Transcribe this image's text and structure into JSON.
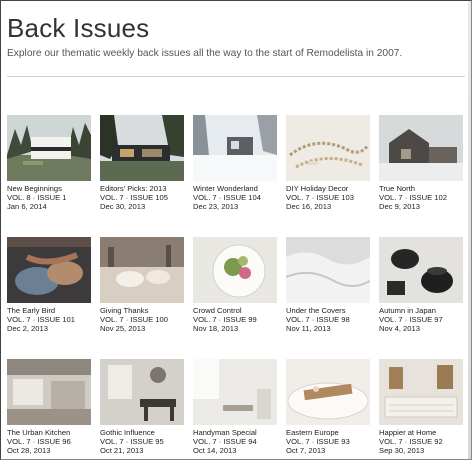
{
  "header": {
    "title": "Back Issues",
    "subtitle": "Explore our thematic weekly back issues all the way to the start of Remodelista in 2007."
  },
  "issues": [
    {
      "title": "New Beginnings",
      "volume": "VOL. 8 · ISSUE 1",
      "date": "Jan 6, 2014",
      "thumb_icon": "modern-house-in-trees-image"
    },
    {
      "title": "Editors' Picks: 2013",
      "volume": "VOL. 7 · ISSUE 105",
      "date": "Dec 30, 2013",
      "thumb_icon": "dark-house-at-dusk-image"
    },
    {
      "title": "Winter Wonderland",
      "volume": "VOL. 7 · ISSUE 104",
      "date": "Dec 23, 2013",
      "thumb_icon": "snowy-cabin-image"
    },
    {
      "title": "DIY Holiday Decor",
      "volume": "VOL. 7 · ISSUE 103",
      "date": "Dec 16, 2013",
      "thumb_icon": "beaded-garland-image"
    },
    {
      "title": "True North",
      "volume": "VOL. 7 · ISSUE 102",
      "date": "Dec 9, 2013",
      "thumb_icon": "barn-house-image"
    },
    {
      "title": "The Early Bird",
      "volume": "VOL. 7 · ISSUE 101",
      "date": "Dec 2, 2013",
      "thumb_icon": "knitting-hands-image"
    },
    {
      "title": "Giving Thanks",
      "volume": "VOL. 7 · ISSUE 100",
      "date": "Nov 25, 2013",
      "thumb_icon": "table-setting-image"
    },
    {
      "title": "Crowd Control",
      "volume": "VOL. 7 · ISSUE 99",
      "date": "Nov 18, 2013",
      "thumb_icon": "salad-plate-image"
    },
    {
      "title": "Under the Covers",
      "volume": "VOL. 7 · ISSUE 98",
      "date": "Nov 11, 2013",
      "thumb_icon": "bed-linens-image"
    },
    {
      "title": "Autumn in Japan",
      "volume": "VOL. 7 · ISSUE 97",
      "date": "Nov 4, 2013",
      "thumb_icon": "tea-kettles-image"
    },
    {
      "title": "The Urban Kitchen",
      "volume": "VOL. 7 · ISSUE 96",
      "date": "Oct 28, 2013",
      "thumb_icon": "loft-kitchen-image"
    },
    {
      "title": "Gothic Influence",
      "volume": "VOL. 7 · ISSUE 95",
      "date": "Oct 21, 2013",
      "thumb_icon": "dining-room-image"
    },
    {
      "title": "Handyman Special",
      "volume": "VOL. 7 · ISSUE 94",
      "date": "Oct 14, 2013",
      "thumb_icon": "white-workshop-image"
    },
    {
      "title": "Eastern Europe",
      "volume": "VOL. 7 · ISSUE 93",
      "date": "Oct 7, 2013",
      "thumb_icon": "bath-tray-image"
    },
    {
      "title": "Happier at Home",
      "volume": "VOL. 7 · ISSUE 92",
      "date": "Sep 30, 2013",
      "thumb_icon": "rug-and-chairs-image"
    }
  ]
}
